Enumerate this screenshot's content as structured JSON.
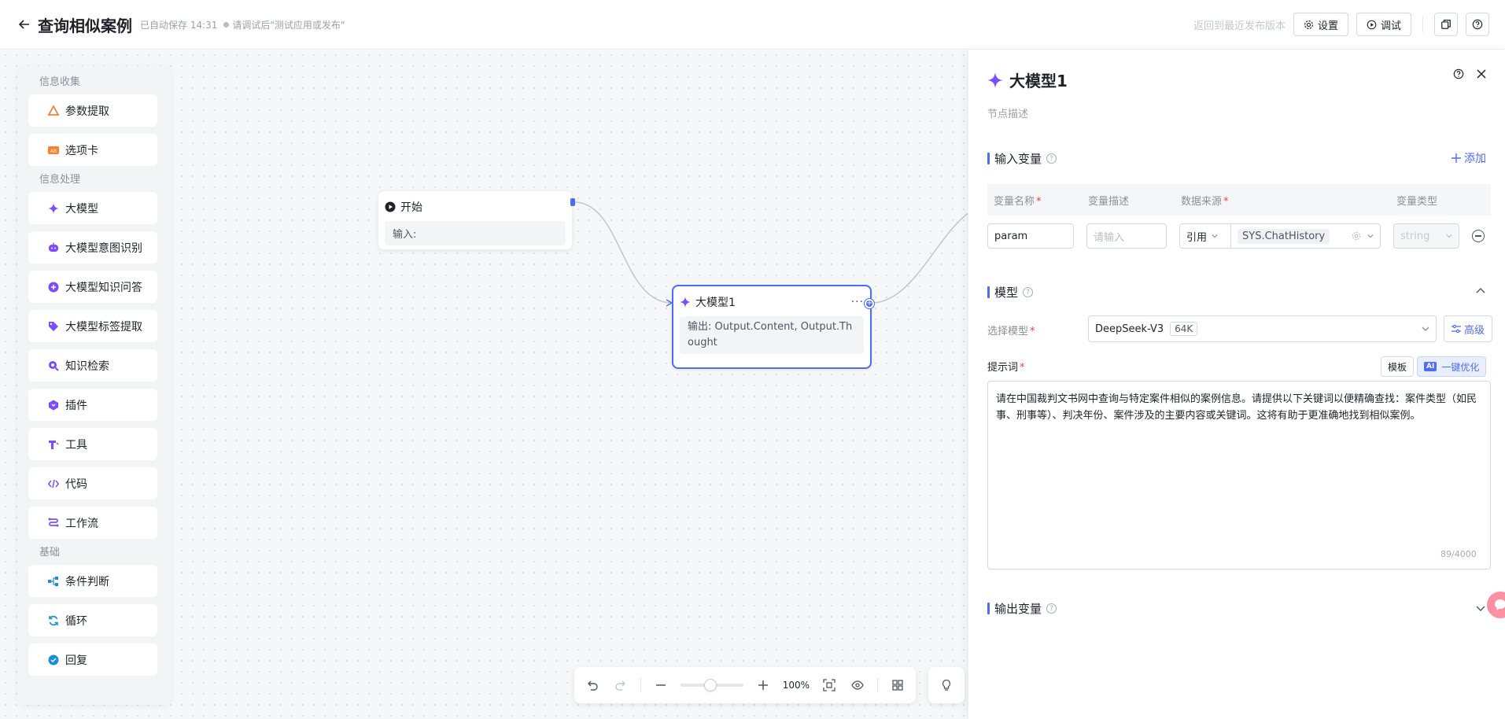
{
  "header": {
    "title": "查询相似案例",
    "autosave": "已自动保存 14:31",
    "hint": "请调试后\"测试应用或发布\"",
    "revert_link": "返回到最近发布版本",
    "settings_label": "设置",
    "debug_label": "调试"
  },
  "palette": {
    "groups": [
      {
        "title": "信息收集",
        "items": [
          {
            "label": "参数提取",
            "icon": "param-extract-icon"
          },
          {
            "label": "选项卡",
            "icon": "option-card-icon"
          }
        ]
      },
      {
        "title": "信息处理",
        "items": [
          {
            "label": "大模型",
            "icon": "llm-sparkle-icon"
          },
          {
            "label": "大模型意图识别",
            "icon": "intent-bot-icon"
          },
          {
            "label": "大模型知识问答",
            "icon": "knowledge-qa-icon"
          },
          {
            "label": "大模型标签提取",
            "icon": "tag-icon"
          },
          {
            "label": "知识检索",
            "icon": "search-icon"
          },
          {
            "label": "插件",
            "icon": "plugin-icon"
          },
          {
            "label": "工具",
            "icon": "tool-icon"
          },
          {
            "label": "代码",
            "icon": "code-icon"
          },
          {
            "label": "工作流",
            "icon": "workflow-icon"
          }
        ]
      },
      {
        "title": "基础",
        "items": [
          {
            "label": "条件判断",
            "icon": "condition-icon"
          },
          {
            "label": "循环",
            "icon": "loop-icon"
          },
          {
            "label": "回复",
            "icon": "reply-icon"
          }
        ]
      }
    ]
  },
  "nodes": {
    "start": {
      "title": "开始",
      "io": "输入:"
    },
    "llm": {
      "title": "大模型1",
      "io": "输出: Output.Content, Output.Thought"
    }
  },
  "toolbar": {
    "zoom": "100%"
  },
  "panel": {
    "title": "大模型1",
    "desc_placeholder": "节点描述",
    "input_vars": {
      "title": "输入变量",
      "add_label": "添加",
      "headers": [
        "变量名称",
        "变量描述",
        "数据来源",
        "变量类型"
      ],
      "row": {
        "name": "param",
        "desc_placeholder": "请输入",
        "source_mode": "引用",
        "source_value": "SYS.ChatHistory",
        "type": "string"
      }
    },
    "model": {
      "title": "模型",
      "select_label": "选择模型",
      "selected": "DeepSeek-V3",
      "context": "64K",
      "advanced_label": "高级",
      "prompt_label": "提示词",
      "template_label": "模板",
      "optimize_label": "一键优化",
      "ai_badge": "AI",
      "prompt_text": "请在中国裁判文书网中查询与特定案件相似的案例信息。请提供以下关键词以便精确查找：案件类型（如民事、刑事等）、判决年份、案件涉及的主要内容或关键词。这将有助于更准确地找到相似案例。",
      "counter": "89/4000"
    },
    "output_vars": {
      "title": "输出变量"
    }
  },
  "colors": {
    "accent": "#4f6cf7",
    "purple": "#7b4dff"
  }
}
